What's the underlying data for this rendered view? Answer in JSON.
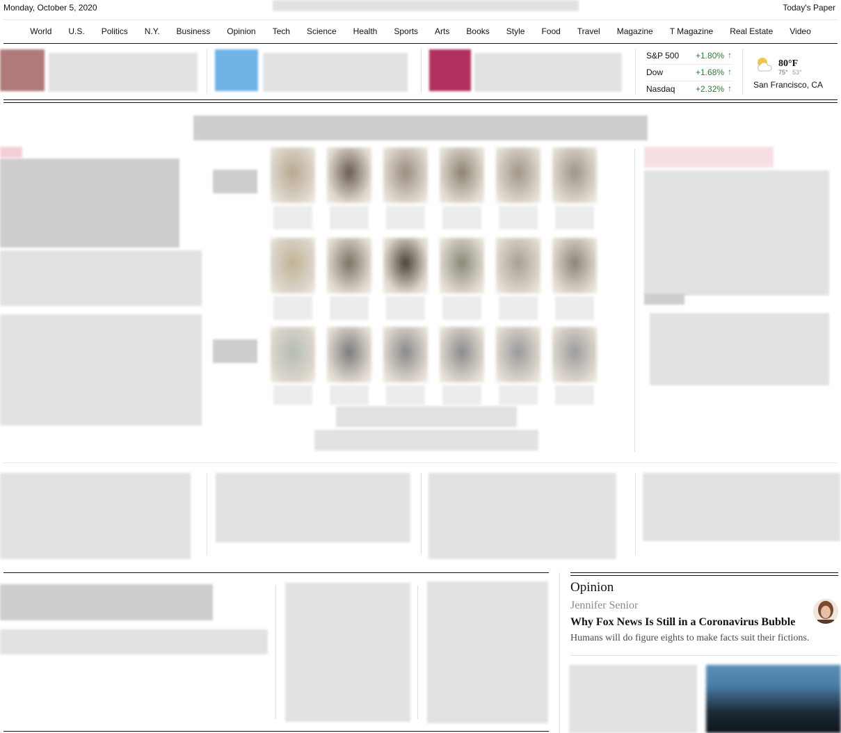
{
  "masthead": {
    "date": "Monday, October 5, 2020",
    "todays_paper": "Today's Paper"
  },
  "nav": [
    "World",
    "U.S.",
    "Politics",
    "N.Y.",
    "Business",
    "Opinion",
    "Tech",
    "Science",
    "Health",
    "Sports",
    "Arts",
    "Books",
    "Style",
    "Food",
    "Travel",
    "Magazine",
    "T Magazine",
    "Real Estate",
    "Video"
  ],
  "markets": [
    {
      "name": "S&P 500",
      "change": "+1.80%"
    },
    {
      "name": "Dow",
      "change": "+1.68%"
    },
    {
      "name": "Nasdaq",
      "change": "+2.32%"
    }
  ],
  "weather": {
    "temp": "80°F",
    "high": "75°",
    "low": "53°",
    "location": "San Francisco, CA",
    "icon": "partly-cloudy-icon"
  },
  "opinion": {
    "section": "Opinion",
    "author": "Jennifer Senior",
    "headline": "Why Fox News Is Still in a Coronavirus Bubble",
    "summary": "Humans will do figure eights to make facts suit their fictions."
  },
  "colors": {
    "market_up": "#2c7a3a",
    "rule": "#121212"
  }
}
